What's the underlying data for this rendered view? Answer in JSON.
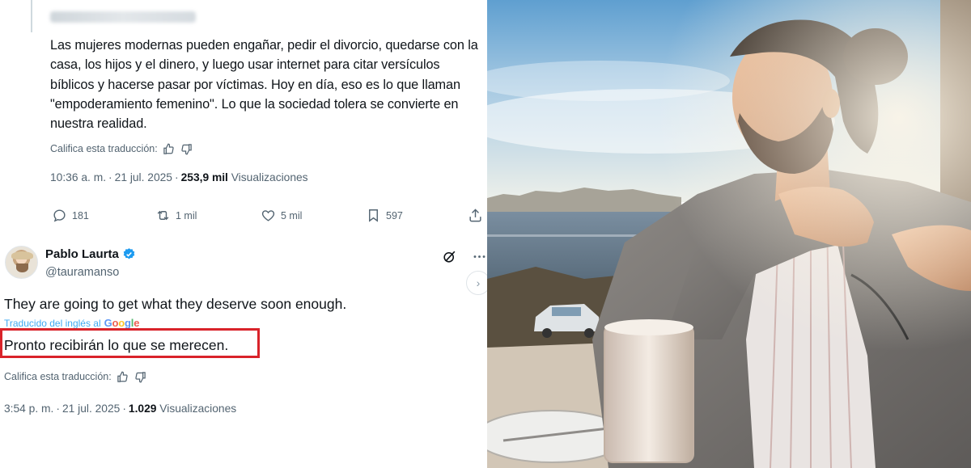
{
  "tweet": {
    "text": "Las mujeres modernas pueden engañar, pedir el divorcio, quedarse con la casa, los hijos y el dinero, y luego usar internet para citar versículos bíblicos y hacerse pasar por víctimas. Hoy en día, eso es lo que llaman \"empoderamiento femenino\". Lo que la sociedad tolera se convierte en nuestra realidad.",
    "rate_label": "Califica esta traducción:",
    "time": "10:36 a. m.",
    "date": "21 jul. 2025",
    "views_count": "253,9 mil",
    "views_label": "Visualizaciones",
    "actions": {
      "replies": "181",
      "retweets": "1 mil",
      "likes": "5 mil",
      "bookmarks": "597"
    }
  },
  "reply": {
    "name": "Pablo Laurta",
    "handle": "@tauramanso",
    "text_en": "They are going to get what they deserve soon enough.",
    "translated_label": "Traducido del inglés al",
    "translator_logo": "Google",
    "text_es": "Pronto recibirán lo que se merecen.",
    "rate_label": "Califica esta traducción:",
    "time": "3:54 p. m.",
    "date": "21 jul. 2025",
    "views_count": "1.029",
    "views_label": "Visualizaciones"
  },
  "colors": {
    "accent": "#1d9bf0",
    "highlight": "#d9232a",
    "secondary_text": "#536471"
  },
  "icons": [
    "reply-icon",
    "retweet-icon",
    "like-icon",
    "bookmark-icon",
    "share-icon",
    "thumbs-up-icon",
    "thumbs-down-icon",
    "verified-badge-icon",
    "grok-icon",
    "more-icon",
    "chevron-right-icon"
  ]
}
